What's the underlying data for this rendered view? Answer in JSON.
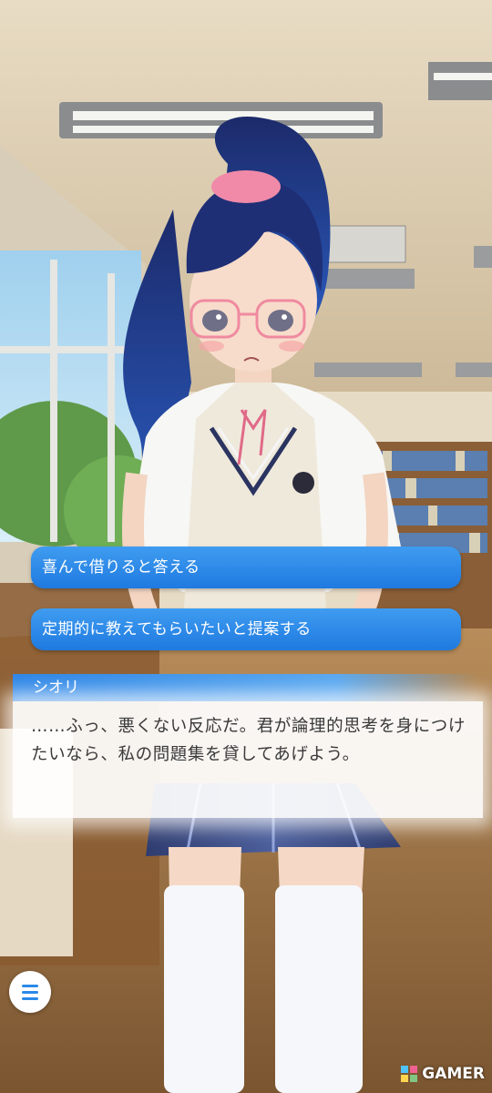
{
  "choices": [
    {
      "label": "喜んで借りると答える"
    },
    {
      "label": "定期的に教えてもらいたいと提案する"
    }
  ],
  "dialogue": {
    "speaker": "シオリ",
    "text": "……ふっ、悪くない反応だ。君が論理的思考を身につけたいなら、私の問題集を貸してあげよう。"
  },
  "menu": {
    "icon": "hamburger-menu-icon"
  },
  "watermark": {
    "text": "GAMER"
  },
  "colors": {
    "accent": "#2a8ae8",
    "choice_bg": "#1f7ae0",
    "text": "#3a3a3a"
  }
}
